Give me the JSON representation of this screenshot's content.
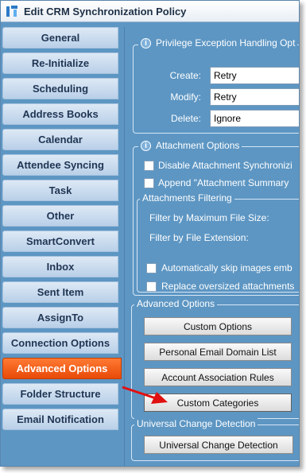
{
  "window": {
    "title": "Edit CRM Synchronization Policy"
  },
  "sidebar": {
    "items": [
      {
        "label": "General"
      },
      {
        "label": "Re-Initialize"
      },
      {
        "label": "Scheduling"
      },
      {
        "label": "Address Books"
      },
      {
        "label": "Calendar"
      },
      {
        "label": "Attendee Syncing"
      },
      {
        "label": "Task"
      },
      {
        "label": "Other"
      },
      {
        "label": "SmartConvert"
      },
      {
        "label": "Inbox"
      },
      {
        "label": "Sent Item"
      },
      {
        "label": "AssignTo"
      },
      {
        "label": "Connection Options"
      },
      {
        "label": "Advanced Options",
        "active": true
      },
      {
        "label": "Folder Structure"
      },
      {
        "label": "Email Notification"
      }
    ]
  },
  "privilege": {
    "legend": "Privilege Exception Handling Opt",
    "create_label": "Create:",
    "create_value": "Retry",
    "modify_label": "Modify:",
    "modify_value": "Retry",
    "delete_label": "Delete:",
    "delete_value": "Ignore"
  },
  "attachment": {
    "legend": "Attachment Options",
    "disable_label": "Disable Attachment Synchronizi",
    "append_label": "Append \"Attachment Summary"
  },
  "filtering": {
    "legend": "Attachments Filtering",
    "max_size_label": "Filter by Maximum File Size:",
    "extension_label": "Filter by File Extension:",
    "skip_images_label": "Automatically skip images emb",
    "replace_oversized_label": "Replace oversized attachments"
  },
  "advanced": {
    "legend": "Advanced Options",
    "custom_options": "Custom Options",
    "personal_domain": "Personal Email Domain List",
    "account_rules": "Account Association Rules",
    "custom_categories": "Custom Categories"
  },
  "universal": {
    "legend": "Universal Change Detection",
    "button": "Universal Change Detection"
  },
  "colors": {
    "panel_bg": "#5d96c3",
    "active_tab": "#e84a08",
    "arrow": "#e01010"
  }
}
